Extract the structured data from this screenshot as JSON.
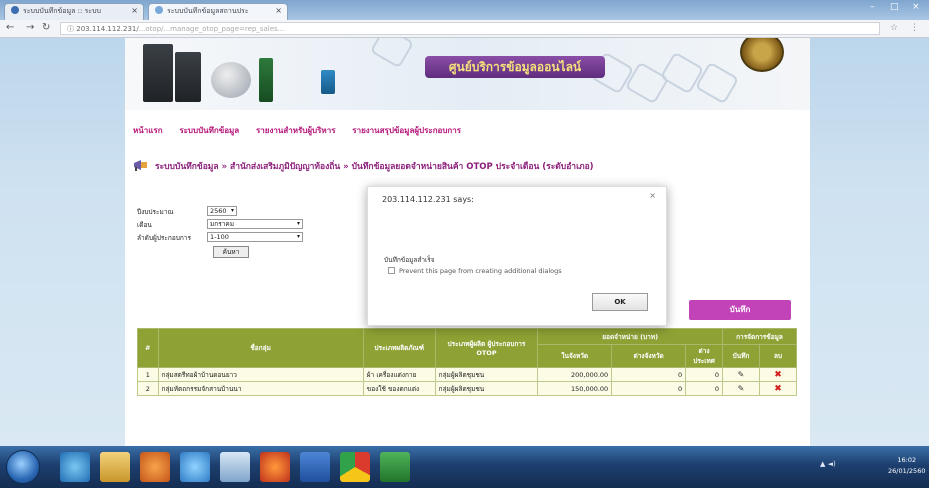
{
  "browser": {
    "tabs": [
      {
        "title": "ระบบบันทึกข้อมูล :: ระบบ",
        "active": false
      },
      {
        "title": "ระบบบันทึกข้อมูลสถานประ",
        "active": true
      }
    ],
    "address": "203.114.112.231/",
    "address_path": "...otop/...manage_otop_page=rep_sales..."
  },
  "banner": {
    "title": "ศูนย์บริการข้อมูลออนไลน์"
  },
  "topnav": {
    "items": [
      "หน้าแรก",
      "ระบบบันทึกข้อมูล",
      "รายงานสำหรับผู้บริหาร",
      "รายงานสรุปข้อมูลผู้ประกอบการ"
    ]
  },
  "breadcrumb": "ระบบบันทึกข้อมูล » สำนักส่งเสริมภูมิปัญญาท้องถิ่น » บันทึกข้อมูลยอดจำหน่ายสินค้า OTOP ประจำเดือน (ระดับอำเภอ)",
  "form": {
    "year_label": "ปีงบประมาณ",
    "year_value": "2560",
    "month_label": "เดือน",
    "month_value": "มกราคม",
    "group_label": "ลำดับผู้ประกอบการ",
    "group_value": "1-100",
    "search_label": "ค้นหา"
  },
  "dialog": {
    "title": "203.114.112.231 says:",
    "close": "×",
    "message": "บันทึกข้อมูลสำเร็จ",
    "checkbox_label": "Prevent this page from creating additional dialogs",
    "ok_label": "OK"
  },
  "save_button": "บันทึก",
  "table": {
    "headers": [
      "#",
      "ชื่อกลุ่ม",
      "ประเภทผลิตภัณฑ์",
      "ประเภทผู้ผลิต ผู้ประกอบการ OTOP",
      "ยอดจำหน่าย (บาท)",
      "การจัดการข้อมูล"
    ],
    "subheaders": [
      "ในจังหวัด",
      "ต่างจังหวัด",
      "ต่างประเทศ",
      "บันทึก",
      "ลบ"
    ],
    "rows": [
      {
        "no": "1",
        "name": "กลุ่มสตรีทอผ้าบ้านดอนยาว",
        "type": "ผ้า เครื่องแต่งกาย",
        "producer": "กลุ่มผู้ผลิตชุมชน",
        "in": "200,000.00",
        "out": "0",
        "foreign": "0"
      },
      {
        "no": "2",
        "name": "กลุ่มหัตถกรรมจักสานบ้านนา",
        "type": "ของใช้ ของตกแต่ง",
        "producer": "กลุ่มผู้ผลิตชุมชน",
        "in": "150,000.00",
        "out": "0",
        "foreign": "0"
      }
    ]
  },
  "taskbar": {
    "time": "16:02",
    "date": "26/01/2560"
  },
  "colors": {
    "accent": "#c243b7",
    "table_header": "#8ea134",
    "nav_text": "#b5177a"
  }
}
